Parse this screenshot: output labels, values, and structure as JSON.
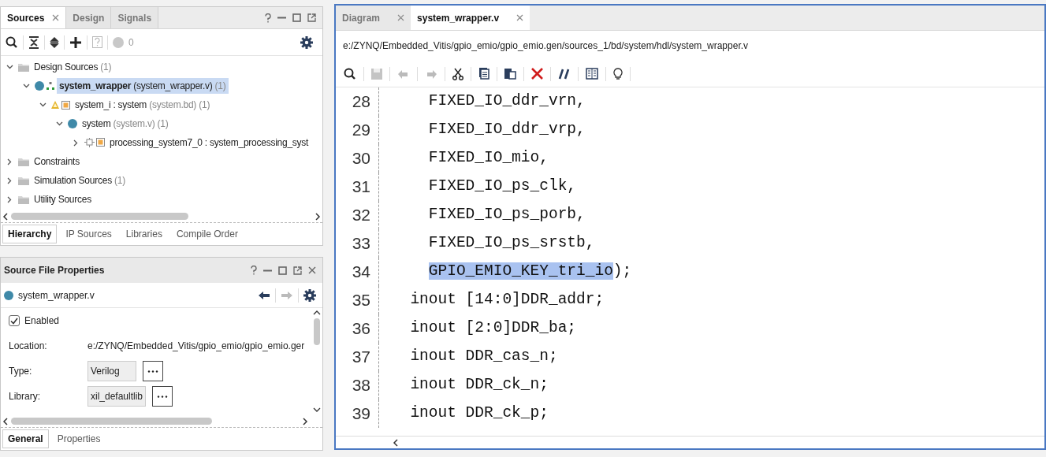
{
  "sources_panel": {
    "tabs": [
      {
        "label": "Sources",
        "selected": true,
        "closable": true
      },
      {
        "label": "Design",
        "selected": false,
        "closable": false
      },
      {
        "label": "Signals",
        "selected": false,
        "closable": false
      }
    ],
    "toolbar": {
      "count": "0"
    },
    "tree": [
      {
        "label": "Design Sources",
        "count": "(1)",
        "kind": "folder",
        "expanded": true,
        "selected": false,
        "children": [
          {
            "label": "system_wrapper",
            "detail": "(system_wrapper.v)",
            "count": "(1)",
            "kind": "module_top",
            "expanded": true,
            "selected": true,
            "children": [
              {
                "label": "system_i : system",
                "detail": "(system.bd)",
                "count": "(1)",
                "kind": "block_design",
                "expanded": true,
                "selected": false,
                "children": [
                  {
                    "label": "system",
                    "detail": "(system.v)",
                    "count": "(1)",
                    "kind": "module",
                    "expanded": true,
                    "selected": false,
                    "children": [
                      {
                        "label": "processing_system7_0 : system_processing_syst",
                        "kind": "ip",
                        "expanded": false,
                        "selected": false
                      }
                    ]
                  }
                ]
              }
            ]
          }
        ]
      },
      {
        "label": "Constraints",
        "kind": "folder",
        "expanded": false,
        "selected": false
      },
      {
        "label": "Simulation Sources",
        "count": "(1)",
        "kind": "folder",
        "expanded": false,
        "selected": false
      },
      {
        "label": "Utility Sources",
        "kind": "folder",
        "expanded": false,
        "selected": false
      }
    ],
    "bottom_tabs": [
      {
        "label": "Hierarchy",
        "selected": true
      },
      {
        "label": "IP Sources",
        "selected": false
      },
      {
        "label": "Libraries",
        "selected": false
      },
      {
        "label": "Compile Order",
        "selected": false
      }
    ]
  },
  "properties_panel": {
    "title": "Source File Properties",
    "file": "system_wrapper.v",
    "enabled": {
      "label": "Enabled",
      "checked": true
    },
    "fields": [
      {
        "label": "Location:",
        "value": "e:/ZYNQ/Embedded_Vitis/gpio_emio/gpio_emio.ger",
        "kind": "text"
      },
      {
        "label": "Type:",
        "value": "Verilog",
        "kind": "chooser"
      },
      {
        "label": "Library:",
        "value": "xil_defaultlib",
        "kind": "chooser"
      }
    ],
    "bottom_tabs": [
      {
        "label": "General",
        "selected": true
      },
      {
        "label": "Properties",
        "selected": false
      }
    ]
  },
  "editor": {
    "tabs": [
      {
        "label": "Diagram",
        "selected": false
      },
      {
        "label": "system_wrapper.v",
        "selected": true
      }
    ],
    "path": "e:/ZYNQ/Embedded_Vitis/gpio_emio/gpio_emio.gen/sources_1/bd/system/hdl/system_wrapper.v",
    "lines": [
      {
        "number": "28",
        "segments": [
          {
            "text": "    FIXED_IO_ddr_vrn,",
            "selected": false
          }
        ]
      },
      {
        "number": "29",
        "segments": [
          {
            "text": "    FIXED_IO_ddr_vrp,",
            "selected": false
          }
        ]
      },
      {
        "number": "30",
        "segments": [
          {
            "text": "    FIXED_IO_mio,",
            "selected": false
          }
        ]
      },
      {
        "number": "31",
        "segments": [
          {
            "text": "    FIXED_IO_ps_clk,",
            "selected": false
          }
        ]
      },
      {
        "number": "32",
        "segments": [
          {
            "text": "    FIXED_IO_ps_porb,",
            "selected": false
          }
        ]
      },
      {
        "number": "33",
        "segments": [
          {
            "text": "    FIXED_IO_ps_srstb,",
            "selected": false
          }
        ]
      },
      {
        "number": "34",
        "segments": [
          {
            "text": "    GPIO_EMIO_KEY_tri_io",
            "selected": true
          },
          {
            "text": ");",
            "selected": false
          }
        ]
      },
      {
        "number": "35",
        "segments": [
          {
            "text": "  inout [14:0]DDR_addr;",
            "selected": false
          }
        ]
      },
      {
        "number": "36",
        "segments": [
          {
            "text": "  inout [2:0]DDR_ba;",
            "selected": false
          }
        ]
      },
      {
        "number": "37",
        "segments": [
          {
            "text": "  inout DDR_cas_n;",
            "selected": false
          }
        ]
      },
      {
        "number": "38",
        "segments": [
          {
            "text": "  inout DDR_ck_n;",
            "selected": false
          }
        ]
      },
      {
        "number": "39",
        "segments": [
          {
            "text": "  inout DDR_ck_p;",
            "selected": false
          }
        ]
      }
    ]
  }
}
